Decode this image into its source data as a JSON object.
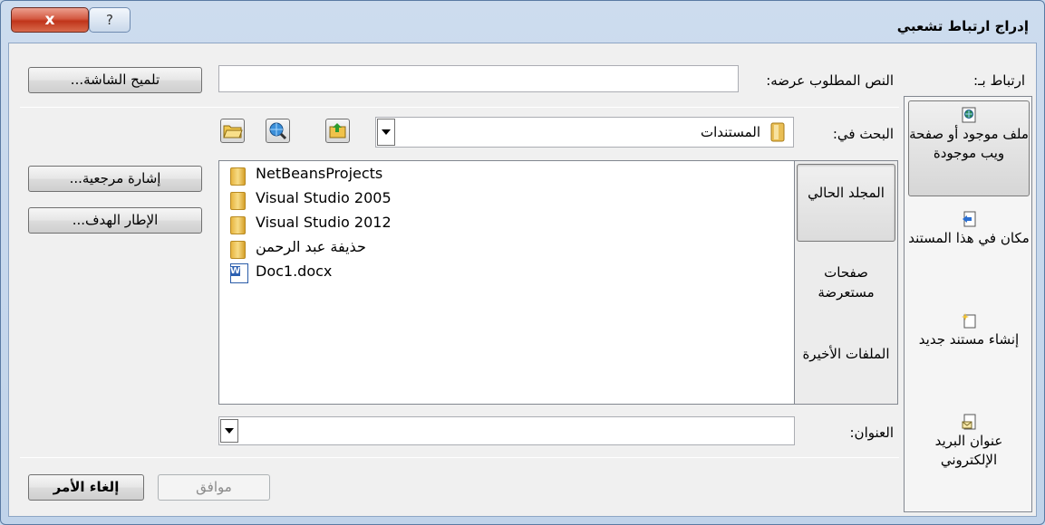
{
  "window": {
    "title": "إدراج ارتباط تشعبي",
    "close_label": "x",
    "help_label": "?"
  },
  "link_to": {
    "label": "ارتباط بـ:",
    "items": [
      {
        "label": "ملف موجود أو صفحة ويب موجودة",
        "icon": "web-page-icon",
        "active": true
      },
      {
        "label": "مكان في هذا المستند",
        "icon": "place-in-document-icon",
        "active": false
      },
      {
        "label": "إنشاء مستند جديد",
        "icon": "new-document-icon",
        "active": false
      },
      {
        "label": "عنوان البريد الإلكتروني",
        "icon": "email-icon",
        "active": false
      }
    ]
  },
  "text_to_display": {
    "label": "النص المطلوب عرضه:",
    "value": ""
  },
  "screentip_button": "تلميح الشاشة...",
  "look_in": {
    "label": "البحث في:",
    "value": "المستندات",
    "folder_icon": "folder-icon"
  },
  "toolbar_icons": [
    "up-folder-icon",
    "browse-web-icon",
    "browse-file-icon"
  ],
  "nav_tabs": [
    {
      "label": "المجلد الحالي",
      "active": true
    },
    {
      "label": "صفحات مستعرضة",
      "active": false
    },
    {
      "label": "الملفات الأخيرة",
      "active": false
    }
  ],
  "files": [
    {
      "name": "NetBeansProjects",
      "type": "folder"
    },
    {
      "name": "Visual Studio 2005",
      "type": "folder"
    },
    {
      "name": "Visual Studio 2012",
      "type": "folder"
    },
    {
      "name": "حذيفة عبد الرحمن",
      "type": "folder"
    },
    {
      "name": "Doc1.docx",
      "type": "word-document"
    }
  ],
  "bookmark_button": "إشارة مرجعية...",
  "target_frame_button": "الإطار الهدف...",
  "address": {
    "label": "العنوان:",
    "value": ""
  },
  "ok_button": "موافق",
  "cancel_button": "إلغاء الأمر",
  "colors": {
    "close_button": "#c8432b",
    "frame": "#c7d8ec",
    "dialog_body": "#f0f0f0"
  }
}
